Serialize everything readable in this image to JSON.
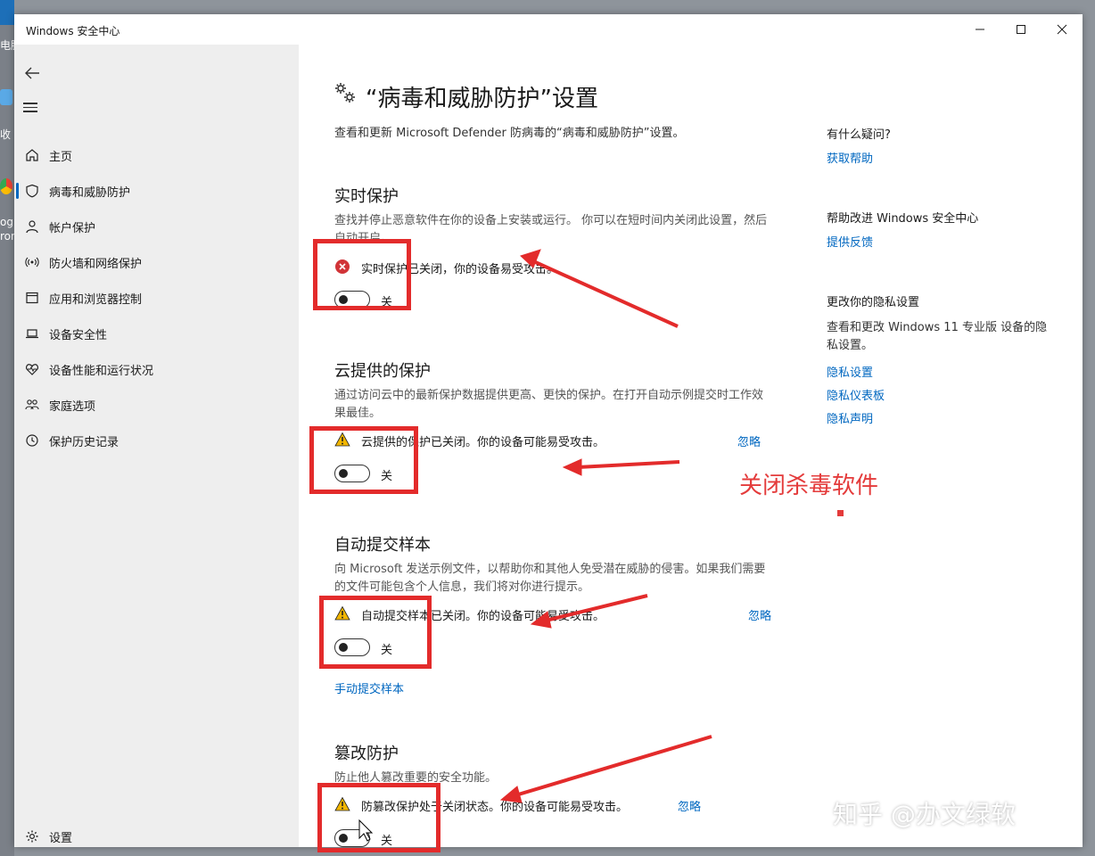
{
  "desktop": {
    "labels": [
      "电脑",
      "收",
      "og",
      "ron"
    ]
  },
  "window": {
    "title": "Windows 安全中心"
  },
  "sidebar": {
    "items": [
      {
        "label": "主页",
        "icon": "home-icon"
      },
      {
        "label": "病毒和威胁防护",
        "icon": "shield-icon"
      },
      {
        "label": "帐户保护",
        "icon": "person-icon"
      },
      {
        "label": "防火墙和网络保护",
        "icon": "wifi-icon"
      },
      {
        "label": "应用和浏览器控制",
        "icon": "app-window-icon"
      },
      {
        "label": "设备安全性",
        "icon": "laptop-icon"
      },
      {
        "label": "设备性能和运行状况",
        "icon": "heart-icon"
      },
      {
        "label": "家庭选项",
        "icon": "family-icon"
      },
      {
        "label": "保护历史记录",
        "icon": "history-icon"
      }
    ],
    "settings_label": "设置"
  },
  "main": {
    "title": "“病毒和威胁防护”设置",
    "subtitle": "查看和更新 Microsoft Defender 防病毒的“病毒和威胁防护”设置。",
    "sections": [
      {
        "title": "实时保护",
        "desc": "查找并停止恶意软件在你的设备上安装或运行。 你可以在短时间内关闭此设置，然后自动开启。",
        "status": "实时保护已关闭，你的设备易受攻击。",
        "toggle": "关"
      },
      {
        "title": "云提供的保护",
        "desc": "通过访问云中的最新保护数据提供更高、更快的保护。在打开自动示例提交时工作效果最佳。",
        "status": "云提供的保护已关闭。你的设备可能易受攻击。",
        "ignore": "忽略",
        "toggle": "关"
      },
      {
        "title": "自动提交样本",
        "desc": "向 Microsoft 发送示例文件，以帮助你和其他人免受潜在威胁的侵害。如果我们需要的文件可能包含个人信息，我们将对你进行提示。",
        "status": "自动提交样本已关闭。你的设备可能易受攻击。",
        "ignore": "忽略",
        "toggle": "关",
        "link": "手动提交样本"
      },
      {
        "title": "篡改防护",
        "desc": "防止他人篡改重要的安全功能。",
        "status": "防篡改保护处于关闭状态。你的设备可能易受攻击。",
        "ignore": "忽略",
        "toggle": "关"
      }
    ]
  },
  "right": {
    "help_head": "有什么疑问?",
    "help_link": "获取帮助",
    "improve_head": "帮助改进 Windows 安全中心",
    "improve_link": "提供反馈",
    "privacy_head": "更改你的隐私设置",
    "privacy_text": "查看和更改 Windows 11 专业版 设备的隐私设置。",
    "privacy_links": [
      "隐私设置",
      "隐私仪表板",
      "隐私声明"
    ]
  },
  "annotation": {
    "text": "关闭杀毒软件",
    "color": "#e43b3b"
  },
  "watermark": "知乎 @办文绿软",
  "colors": {
    "accent": "#0067c0",
    "error": "#d13438",
    "warning": "#f2b600"
  }
}
